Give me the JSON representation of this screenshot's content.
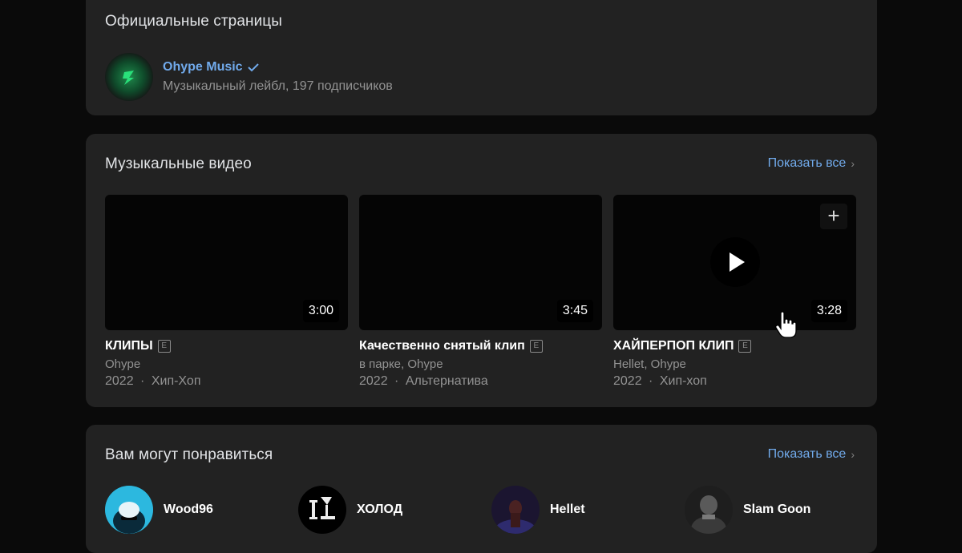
{
  "official": {
    "title": "Официальные страницы",
    "label": {
      "name": "Ohype Music",
      "subtitle": "Музыкальный лейбл, 197 подписчиков"
    }
  },
  "videos": {
    "title": "Музыкальные видео",
    "show_all": "Показать все",
    "items": [
      {
        "title": "КЛИПЫ",
        "explicit": "E",
        "artist": "Ohype",
        "year": "2022",
        "genre": "Хип-Хоп",
        "duration": "3:00"
      },
      {
        "title": "Качественно снятый клип",
        "explicit": "E",
        "artist": "в парке, Ohype",
        "year": "2022",
        "genre": "Альтернатива",
        "duration": "3:45"
      },
      {
        "title": "ХАЙПЕРПОП КЛИП",
        "explicit": "E",
        "artist": "Hellet, Ohype",
        "year": "2022",
        "genre": "Хип-хоп",
        "duration": "3:28"
      }
    ],
    "separator": "·"
  },
  "recommendations": {
    "title": "Вам могут понравиться",
    "show_all": "Показать все",
    "items": [
      {
        "name": "Wood96"
      },
      {
        "name": "ХОЛОД"
      },
      {
        "name": "Hellet"
      },
      {
        "name": "Slam Goon"
      }
    ]
  },
  "colors": {
    "accent": "#71aaeb",
    "card": "#222222",
    "background": "#0a0a0a"
  }
}
